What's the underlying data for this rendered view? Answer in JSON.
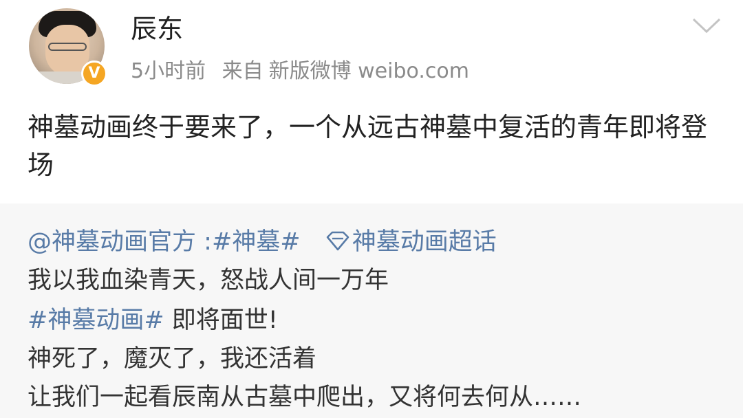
{
  "post": {
    "username": "辰东",
    "verified_badge": "V",
    "time": "5小时前",
    "source_prefix": "来自",
    "source": "新版微博 weibo.com",
    "text": "神墓动画终于要来了，一个从远古神墓中复活的青年即将登场"
  },
  "repost": {
    "mention": "@神墓动画官方",
    "colon": " :",
    "hashtag1": "#神墓#",
    "supertopic": "神墓动画超话",
    "line2": "我以我血染青天，怒战人间一万年",
    "hashtag2": "#神墓动画#",
    "line3_rest": " 即将面世!",
    "line4": "神死了，魔灭了，我还活着",
    "line5": "让我们一起看辰南从古墓中爬出，又将何去何从……"
  },
  "colors": {
    "link": "#587ba7",
    "badge": "#f5a623",
    "repost_bg": "#f7f7f7",
    "meta_text": "#8a8a8a"
  },
  "icons": {
    "chevron": "chevron-down-icon",
    "supertopic": "diamond-icon",
    "verified": "verified-badge-icon"
  }
}
